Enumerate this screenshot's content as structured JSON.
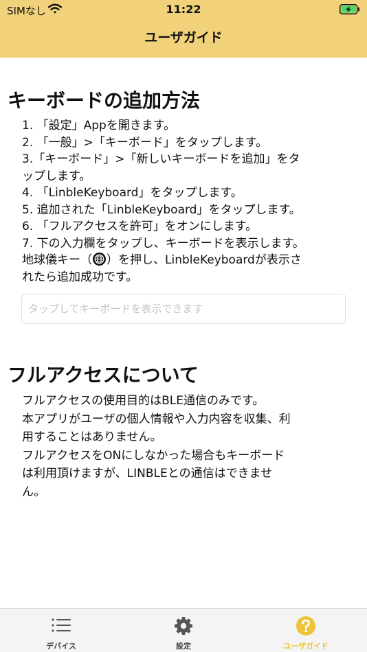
{
  "status_bar": {
    "carrier": "SIMなし",
    "time": "11:22"
  },
  "header": {
    "title": "ユーザガイド"
  },
  "add_keyboard": {
    "title": "キーボードの追加方法",
    "lines": [
      "1. 「設定」Appを開きます。",
      "2. 「一般」>「キーボード」をタップします。",
      "3.「キーボード」>「新しいキーボードを追加」をタ",
      "ップします。",
      "4. 「LinbleKeyboard」をタップします。",
      "5. 追加された「LinbleKeyboard」をタップします。",
      "6. 「フルアクセスを許可」をオンにします。",
      "7.  下の入力欄をタップし、キーボードを表示します。"
    ],
    "globe_line_before": "地球儀キー（",
    "globe_line_after": "）を押し、LinbleKeyboardが表示さ",
    "last_line": "れたら追加成功です。",
    "input_placeholder": "タップしてキーボードを表示できます",
    "input_value": ""
  },
  "full_access": {
    "title": "フルアクセスについて",
    "lines": [
      "フルアクセスの使用目的はBLE通信のみです。",
      "本アプリがユーザの個人情報や入力内容を収集、利",
      "用することはありません。",
      "フルアクセスをONにしなかった場合もキーボード",
      "は利用頂けますが、LINBLEとの通信はできませ",
      "ん。"
    ]
  },
  "tabbar": {
    "tabs": [
      {
        "label": "デバイス",
        "icon": "list-icon",
        "active": false
      },
      {
        "label": "設定",
        "icon": "gear-icon",
        "active": false
      },
      {
        "label": "ユーザガイド",
        "icon": "question-icon",
        "active": true
      }
    ]
  },
  "colors": {
    "header_bg": "#f1d27a",
    "accent": "#f0c238",
    "battery_green": "#4cd964",
    "tab_inactive": "#444444"
  }
}
